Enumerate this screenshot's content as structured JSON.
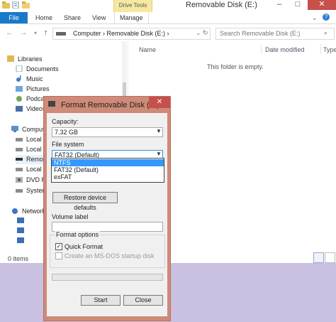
{
  "window": {
    "title": "Removable Disk (E:)",
    "context_tab": "Drive Tools",
    "controls": {
      "minimize": "–",
      "maximize": "□",
      "close": "✕"
    }
  },
  "ribbon": {
    "file": "File",
    "tabs": [
      "Home",
      "Share",
      "View",
      "Manage"
    ]
  },
  "address": {
    "crumbs": "Computer  ›  Removable Disk (E:)  ›",
    "search_placeholder": "Search Removable Disk (E:)"
  },
  "nav_pane": {
    "items": [
      {
        "label": "Libraries",
        "icon": "libraries-icon"
      },
      {
        "label": "Documents",
        "icon": "documents-icon"
      },
      {
        "label": "Music",
        "icon": "music-icon"
      },
      {
        "label": "Pictures",
        "icon": "pictures-icon"
      },
      {
        "label": "Podca",
        "icon": "podcasts-icon"
      },
      {
        "label": "Videos",
        "icon": "videos-icon"
      },
      {
        "label": "Comput",
        "icon": "computer-icon"
      },
      {
        "label": "Local D",
        "icon": "drive-icon"
      },
      {
        "label": "Local D",
        "icon": "drive-icon"
      },
      {
        "label": "Remov",
        "icon": "removable-drive-icon"
      },
      {
        "label": "Local D",
        "icon": "drive-icon"
      },
      {
        "label": "DVD R",
        "icon": "dvd-drive-icon"
      },
      {
        "label": "System",
        "icon": "drive-icon"
      },
      {
        "label": "Network",
        "icon": "network-icon"
      }
    ]
  },
  "columns": [
    "Name",
    "Date modified",
    "Type"
  ],
  "empty_message": "This folder is empty.",
  "status": {
    "items": "0 items"
  },
  "dialog": {
    "title": "Format Removable Disk (E:)",
    "close": "✕",
    "capacity_label": "Capacity:",
    "capacity_value": "7.32 GB",
    "filesystem_label": "File system",
    "filesystem_value": "FAT32 (Default)",
    "filesystem_options": [
      "NTFS",
      "FAT32 (Default)",
      "exFAT"
    ],
    "filesystem_highlighted": "NTFS",
    "restore_button": "Restore device defaults",
    "volume_label": "Volume label",
    "volume_value": "",
    "format_options_label": "Format options",
    "quick_format_label": "Quick Format",
    "quick_format_checked": true,
    "msdos_label": "Create an MS-DOS startup disk",
    "msdos_checked": false,
    "progress": 0,
    "start_button": "Start",
    "close_button": "Close"
  },
  "colors": {
    "file_tab": "#1979ca",
    "drive_tools": "#f6e7a1",
    "dialog_frame": "#cf8a78",
    "selection": "#3399ff",
    "desktop": "#c9c0e2"
  }
}
